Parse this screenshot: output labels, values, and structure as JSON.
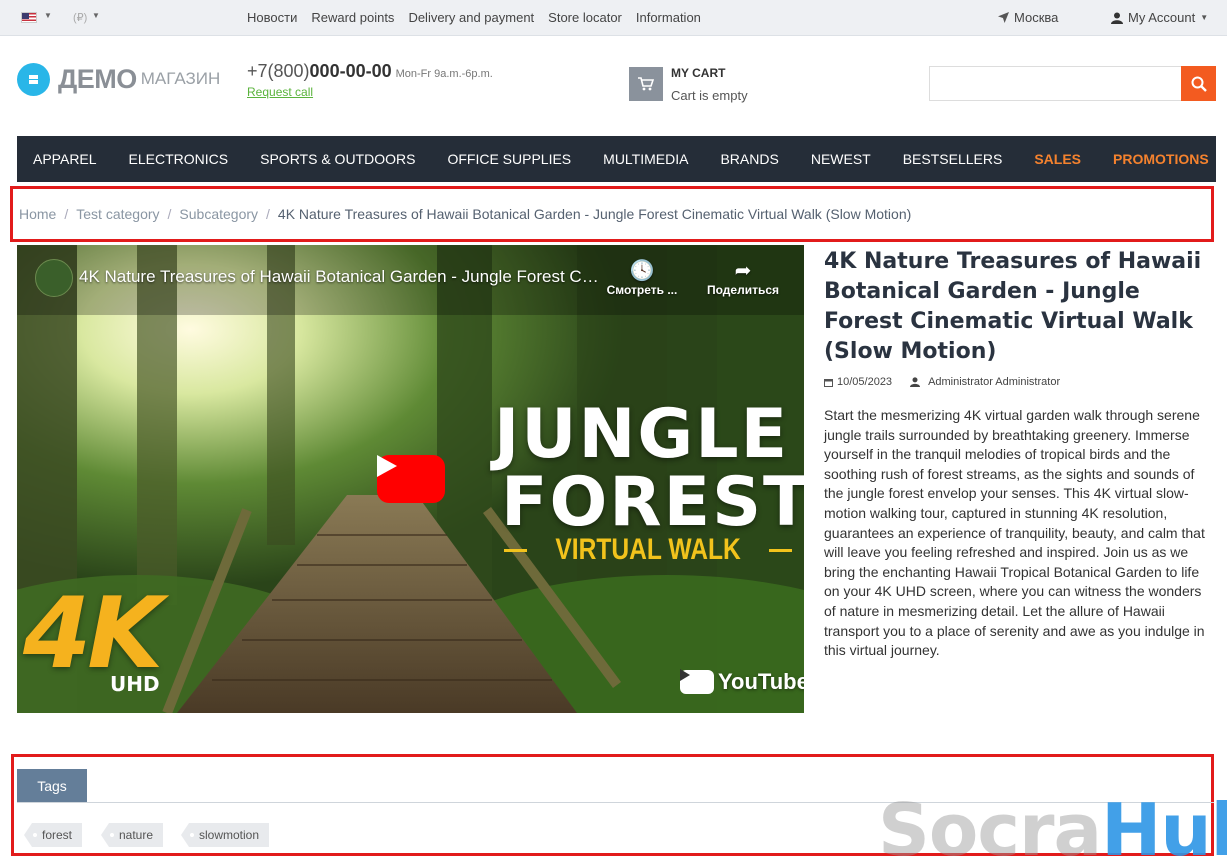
{
  "topbar": {
    "currency": "(₽)",
    "links": [
      "Новости",
      "Reward points",
      "Delivery and payment",
      "Store locator",
      "Information"
    ],
    "city": "Москва",
    "account": "My Account"
  },
  "header": {
    "logo_word1": "ДЕМО",
    "logo_word2": "МАГАЗИН",
    "phone_prefix": "+7(800)",
    "phone_main": "000-00-00",
    "hours": "Mon-Fr 9a.m.-6p.m.",
    "request_call": "Request call",
    "cart_title": "MY CART",
    "cart_status": "Cart is empty",
    "search_value": ""
  },
  "nav": {
    "items": [
      "APPAREL",
      "ELECTRONICS",
      "SPORTS & OUTDOORS",
      "OFFICE SUPPLIES",
      "MULTIMEDIA",
      "BRANDS",
      "NEWEST",
      "BESTSELLERS",
      "SALES",
      "PROMOTIONS"
    ]
  },
  "breadcrumb": {
    "home": "Home",
    "level1": "Test category",
    "level2": "Subcategory",
    "separator": "/",
    "current": "4K Nature Treasures of Hawaii Botanical Garden - Jungle Forest Cinematic Virtual Walk (Slow Motion)"
  },
  "video": {
    "title": "4K Nature Treasures of Hawaii Botanical Garden - Jungle Forest Cinematic Virtual Walk (Slow Motion)",
    "watch_later": "Смотреть ...",
    "share": "Поделиться",
    "thumb_line1": "JUNGLE",
    "thumb_line2": "FOREST",
    "thumb_line3": "VIRTUAL WALK",
    "thumb_4k": "4K",
    "thumb_uhd": "UHD",
    "youtube": "YouTube"
  },
  "article": {
    "title": "4K Nature Treasures of Hawaii Botanical Garden - Jungle Forest Cinematic Virtual Walk (Slow Motion)",
    "date": "10/05/2023",
    "author": "Administrator Administrator",
    "body": "Start the mesmerizing 4K virtual garden walk through serene jungle trails surrounded by breathtaking greenery. Immerse yourself in the tranquil melodies of tropical birds and the soothing rush of forest streams, as the sights and sounds of the jungle forest envelop your senses. This 4K virtual slow-motion walking tour, captured in stunning 4K resolution, guarantees an experience of tranquility, beauty, and calm that will leave you feeling refreshed and inspired. Join us as we bring the enchanting Hawaii Tropical Botanical Garden to life on your 4K UHD screen, where you can witness the wonders of nature in mesmerizing detail. Let the allure of Hawaii transport you to a place of serenity and awe as you indulge in this virtual journey."
  },
  "tags": {
    "tab_label": "Tags",
    "items": [
      "forest",
      "nature",
      "slowmotion"
    ]
  },
  "watermark": {
    "part1": "Socra",
    "part2": "Hub"
  },
  "colors": {
    "nav_bg": "#252d38",
    "accent_orange": "#f35b20",
    "highlight_red": "#e21b1b",
    "tab_blue": "#647e99"
  }
}
